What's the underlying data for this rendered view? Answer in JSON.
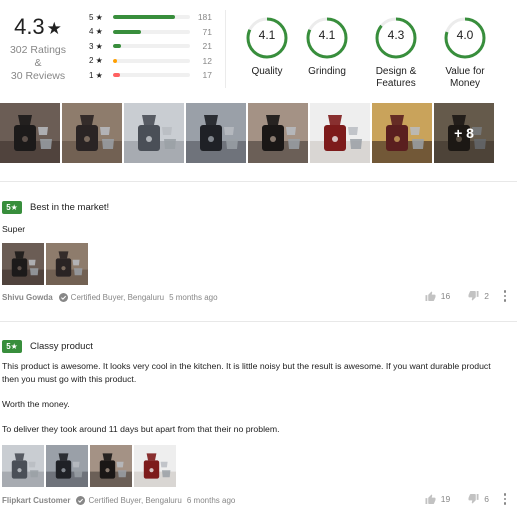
{
  "summary": {
    "average": "4.3",
    "star_glyph": "★",
    "ratings_text": "302 Ratings &",
    "reviews_text": "30 Reviews",
    "distribution": [
      {
        "label": "5 ★",
        "count": "181",
        "fraction": 0.8,
        "color": "#388e3c"
      },
      {
        "label": "4 ★",
        "count": "71",
        "fraction": 0.36,
        "color": "#388e3c"
      },
      {
        "label": "3 ★",
        "count": "21",
        "fraction": 0.11,
        "color": "#388e3c"
      },
      {
        "label": "2 ★",
        "count": "12",
        "fraction": 0.05,
        "color": "#ff9f00"
      },
      {
        "label": "1 ★",
        "count": "17",
        "fraction": 0.09,
        "color": "#ff6161"
      }
    ],
    "aspects": [
      {
        "value": "4.1",
        "label": "Quality",
        "fraction": 0.82
      },
      {
        "value": "4.1",
        "label": "Grinding",
        "fraction": 0.82
      },
      {
        "value": "4.3",
        "label": "Design & Features",
        "fraction": 0.86
      },
      {
        "value": "4.0",
        "label": "Value for Money",
        "fraction": 0.8
      }
    ],
    "ring_color": "#388e3c"
  },
  "gallery": {
    "more_label": "+ 8",
    "photos": [
      "mixer-grinder-photo-1",
      "mixer-grinder-photo-2",
      "mixer-grinder-photo-3",
      "mixer-grinder-photo-4",
      "mixer-grinder-photo-5",
      "mixer-grinder-photo-6",
      "mixer-grinder-photo-7",
      "mixer-grinder-photo-8"
    ]
  },
  "reviews": [
    {
      "rating": "5★",
      "title": "Best in the market!",
      "paragraphs": [
        "Super"
      ],
      "photo_count": 2,
      "author": "Shivu Gowda",
      "buyer": "Certified Buyer, Bengaluru",
      "age": "5 months ago",
      "likes": "16",
      "dislikes": "2"
    },
    {
      "rating": "5★",
      "title": "Classy product",
      "paragraphs": [
        "This product is awesome. It looks very cool in the kitchen. It is little noisy but the result is awesome. If you want durable product then you must go with this product.",
        "Worth the money.",
        "To deliver they took around 11 days but apart from that their no problem."
      ],
      "photo_count": 4,
      "author": "Flipkart Customer",
      "buyer": "Certified Buyer, Bengaluru",
      "age": "6 months ago",
      "likes": "19",
      "dislikes": "6"
    }
  ],
  "icons": {
    "verified": "check-circle-icon",
    "like": "thumbs-up-icon",
    "dislike": "thumbs-down-icon",
    "menu": "more-vertical-icon"
  }
}
